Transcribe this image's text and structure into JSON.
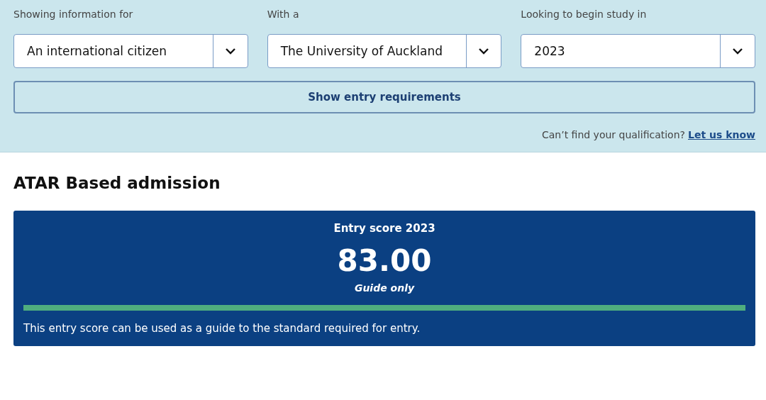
{
  "filters": [
    {
      "label": "Showing information for",
      "value": "An international citizen"
    },
    {
      "label": "With a",
      "value": "The University of Auckland"
    },
    {
      "label": "Looking to begin study in",
      "value": "2023"
    }
  ],
  "submit_button": "Show entry requirements",
  "help": {
    "text": "Can’t find your qualification?",
    "link": "Let us know"
  },
  "section_title": "ATAR Based admission",
  "score_card": {
    "title": "Entry score 2023",
    "score": "83.00",
    "note": "Guide only",
    "description": "This entry score can be used as a guide to the standard required for entry."
  }
}
